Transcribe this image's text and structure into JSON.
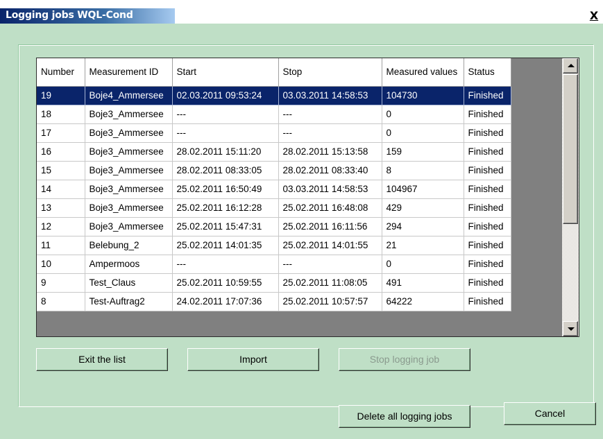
{
  "window": {
    "title": "Logging jobs WQL-Cond",
    "close_symbol": "X"
  },
  "table": {
    "columns": [
      "Number",
      "Measurement ID",
      "Start",
      "Stop",
      "Measured values",
      "Status"
    ],
    "selected_index": 0,
    "rows": [
      {
        "number": "19",
        "id": "Boje4_Ammersee",
        "start": "02.03.2011 09:53:24",
        "stop": "03.03.2011 14:58:53",
        "values": "104730",
        "status": "Finished"
      },
      {
        "number": "18",
        "id": "Boje3_Ammersee",
        "start": "---",
        "stop": "---",
        "values": "0",
        "status": "Finished"
      },
      {
        "number": "17",
        "id": "Boje3_Ammersee",
        "start": "---",
        "stop": "---",
        "values": "0",
        "status": "Finished"
      },
      {
        "number": "16",
        "id": "Boje3_Ammersee",
        "start": "28.02.2011 15:11:20",
        "stop": "28.02.2011 15:13:58",
        "values": "159",
        "status": "Finished"
      },
      {
        "number": "15",
        "id": "Boje3_Ammersee",
        "start": "28.02.2011 08:33:05",
        "stop": "28.02.2011 08:33:40",
        "values": "8",
        "status": "Finished"
      },
      {
        "number": "14",
        "id": "Boje3_Ammersee",
        "start": "25.02.2011 16:50:49",
        "stop": "03.03.2011 14:58:53",
        "values": "104967",
        "status": "Finished"
      },
      {
        "number": "13",
        "id": "Boje3_Ammersee",
        "start": "25.02.2011 16:12:28",
        "stop": "25.02.2011 16:48:08",
        "values": "429",
        "status": "Finished"
      },
      {
        "number": "12",
        "id": "Boje3_Ammersee",
        "start": "25.02.2011 15:47:31",
        "stop": "25.02.2011 16:11:56",
        "values": "294",
        "status": "Finished"
      },
      {
        "number": "11",
        "id": "Belebung_2",
        "start": "25.02.2011 14:01:35",
        "stop": "25.02.2011 14:01:55",
        "values": "21",
        "status": "Finished"
      },
      {
        "number": "10",
        "id": "Ampermoos",
        "start": "---",
        "stop": "---",
        "values": "0",
        "status": "Finished"
      },
      {
        "number": "9",
        "id": "Test_Claus",
        "start": "25.02.2011 10:59:55",
        "stop": "25.02.2011 11:08:05",
        "values": "491",
        "status": "Finished"
      },
      {
        "number": "8",
        "id": "Test-Auftrag2",
        "start": "24.02.2011 17:07:36",
        "stop": "25.02.2011 10:57:57",
        "values": "64222",
        "status": "Finished"
      }
    ]
  },
  "buttons": {
    "exit": "Exit the list",
    "import": "Import",
    "stop": "Stop logging job",
    "delete_all": "Delete all logging jobs",
    "cancel": "Cancel"
  },
  "colors": {
    "dialog_background": "#bfdfc6",
    "selection": "#0a246a",
    "titlebar_start": "#0a246a"
  }
}
